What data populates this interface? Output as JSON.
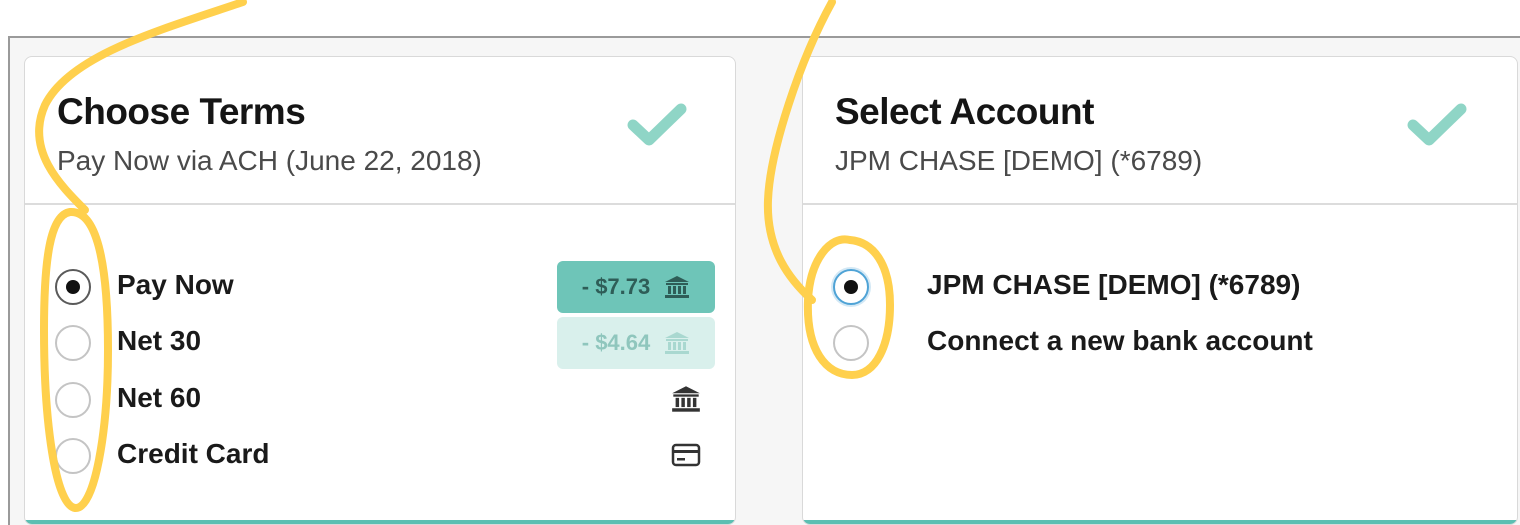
{
  "terms_card": {
    "title": "Choose Terms",
    "subtitle": "Pay Now via ACH (June 22, 2018)",
    "status_icon": "check-icon",
    "options": [
      {
        "label": "Pay Now",
        "selected": true,
        "price": "- $7.73",
        "price_style": "active",
        "icon": "bank-icon"
      },
      {
        "label": "Net 30",
        "selected": false,
        "price": "- $4.64",
        "price_style": "muted",
        "icon": "bank-icon"
      },
      {
        "label": "Net 60",
        "selected": false,
        "icon": "bank-icon"
      },
      {
        "label": "Credit Card",
        "selected": false,
        "icon": "credit-card-icon"
      }
    ]
  },
  "account_card": {
    "title": "Select Account",
    "subtitle": "JPM CHASE [DEMO] (*6789)",
    "status_icon": "check-icon",
    "options": [
      {
        "label": "JPM CHASE [DEMO] (*6789)",
        "selected": true
      },
      {
        "label": "Connect a new bank account",
        "selected": false
      }
    ]
  },
  "colors": {
    "accent": "#6ec5b8",
    "check": "#8fd5c6",
    "annotation": "#ffd04d",
    "card_border_bottom": "#5bbfb2"
  }
}
